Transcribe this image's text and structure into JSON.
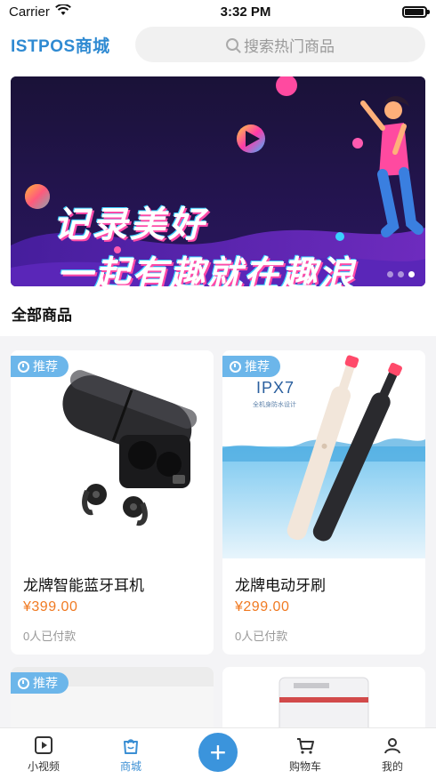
{
  "status_bar": {
    "carrier": "Carrier",
    "time": "3:32 PM",
    "battery_level": 0.95
  },
  "header": {
    "brand": "ISTPOS商城",
    "search_placeholder": "搜索热门商品"
  },
  "banner": {
    "line1": "记录美好",
    "line2": "一起有趣就在趣浪",
    "dots": 3,
    "active_dot": 3
  },
  "section": {
    "title": "全部商品"
  },
  "products": [
    {
      "tag": "推荐",
      "name": "龙牌智能蓝牙耳机",
      "price": "¥399.00",
      "sold": "0人已付款"
    },
    {
      "tag": "推荐",
      "name": "龙牌电动牙刷",
      "price": "¥299.00",
      "sold": "0人已付款",
      "image_text": "IPX7",
      "image_subtext": "全机身防水设计"
    },
    {
      "tag": "推荐"
    },
    {}
  ],
  "tab_bar": {
    "tabs": [
      {
        "label": "小视频",
        "icon": "video-icon"
      },
      {
        "label": "商城",
        "icon": "bag-icon",
        "active": true
      },
      {
        "label": "",
        "icon": "plus-icon"
      },
      {
        "label": "购物车",
        "icon": "cart-icon"
      },
      {
        "label": "我的",
        "icon": "profile-icon"
      }
    ]
  },
  "colors": {
    "brand": "#2f8ad2",
    "price": "#f07a22",
    "tag": "#6cb6ea",
    "active_tab": "#3b8fd4",
    "fab": "#3b94dc"
  }
}
